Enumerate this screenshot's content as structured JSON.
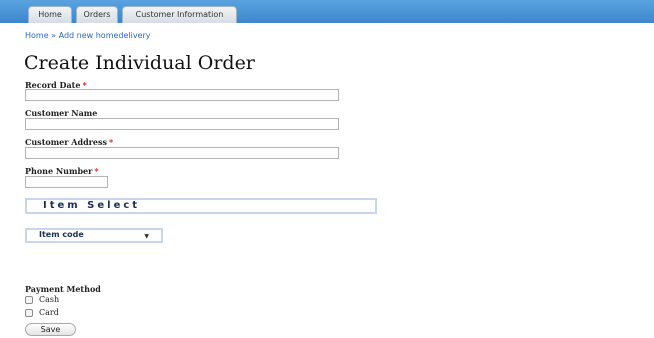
{
  "tabs": [
    {
      "label": "Home"
    },
    {
      "label": "Orders"
    },
    {
      "label": "Customer Information"
    }
  ],
  "breadcrumb": {
    "home": "Home",
    "separator": "»",
    "current": "Add new homedelivery"
  },
  "page_title": "Create Individual Order",
  "form": {
    "record_date": {
      "label": "Record Date",
      "required_marker": "*",
      "value": ""
    },
    "customer_name": {
      "label": "Customer Name",
      "value": ""
    },
    "customer_address": {
      "label": "Customer Address",
      "required_marker": "*",
      "value": ""
    },
    "phone_number": {
      "label": "Phone Number",
      "required_marker": "*",
      "value": ""
    },
    "item_select": {
      "label": "Item Select"
    },
    "item_code": {
      "selected": "Item code",
      "arrow_icon": "dropdown-arrow-icon"
    },
    "payment_method": {
      "label": "Payment Method",
      "options": [
        {
          "label": "Cash",
          "checked": false
        },
        {
          "label": "Card",
          "checked": false
        }
      ]
    },
    "save_label": "Save"
  },
  "colors": {
    "tabbar": "#3d86cc",
    "link": "#2a6bb0",
    "required": "#dd2222",
    "select_border": "#c6d7ec"
  }
}
